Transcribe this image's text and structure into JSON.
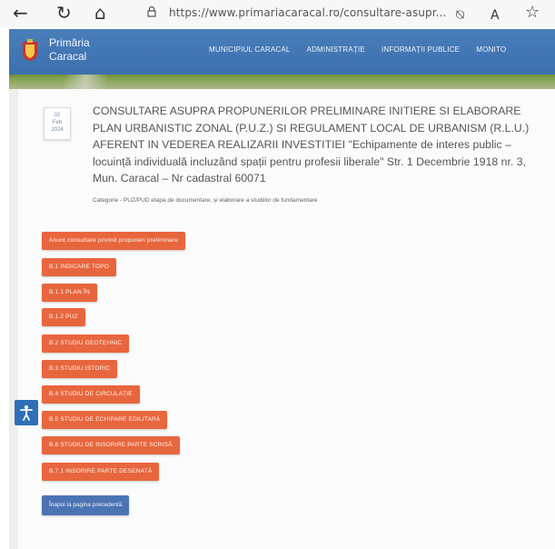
{
  "browser": {
    "url": "https://www.primariacaracal.ro/consultare-asupr..."
  },
  "site": {
    "logo_line1": "Primăria",
    "logo_line2": "Caracal",
    "nav": [
      "MUNICIPIUL CARACAL",
      "ADMINISTRAȚIE",
      "INFORMAȚII PUBLICE",
      "MONITO"
    ]
  },
  "badge": {
    "line1": "02",
    "line2": "Feb",
    "line3": "2024"
  },
  "page": {
    "title": "CONSULTARE ASUPRA PROPUNERILOR PRELIMINARE INITIERE SI ELABORARE PLAN URBANISTIC ZONAL (P.U.Z.) SI REGULAMENT LOCAL DE URBANISM (R.L.U.) AFERENT IN VEDEREA REALIZARII INVESTITIEI \"Echipamente de interes public – locuință individuală incluzând spații pentru profesii liberale\" Str. 1 Decembrie 1918 nr. 3, Mun. Caracal – Nr cadastral 60071",
    "category": "Categorie - PUZ/PUD etapa de documentare, și elaborare a studiilor de fundamentare"
  },
  "documents": [
    "Anunț consultare privind propuneri preliminare",
    "B.1 INDICARE TOPO",
    "B.1.1 PLAN ÎN",
    "B.1.2 PUZ",
    "B.2 Studiu Geotehnic",
    "B.3 STUDIU ISTORIC",
    "B.4 STUDIU DE CIRCULAȚIE",
    "B.5 STUDIU DE ECHIPARE EDILITARĂ",
    "B.6 STUDIU DE INSORIRE PARTE SCRISĂ",
    "B.7.1 INSORIRE PARTE DESENATĂ"
  ],
  "back_label": "Înapoi la pagina precedentă",
  "colors": {
    "header": "#3c6fae",
    "doc_button": "#e8663d",
    "back_button": "#4b74b3"
  }
}
